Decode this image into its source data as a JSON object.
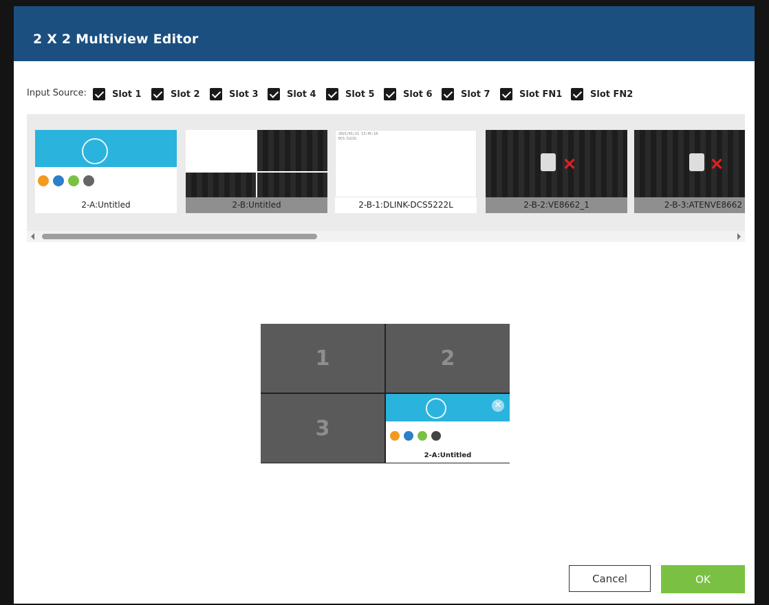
{
  "dialog": {
    "title": "2 X 2 Multiview Editor"
  },
  "input_source": {
    "label": "Input Source:",
    "slots": [
      {
        "label": "Slot 1",
        "checked": true
      },
      {
        "label": "Slot 2",
        "checked": true
      },
      {
        "label": "Slot 3",
        "checked": true
      },
      {
        "label": "Slot 4",
        "checked": true
      },
      {
        "label": "Slot 5",
        "checked": true
      },
      {
        "label": "Slot 6",
        "checked": true
      },
      {
        "label": "Slot 7",
        "checked": true
      },
      {
        "label": "Slot FN1",
        "checked": true
      },
      {
        "label": "Slot FN2",
        "checked": true
      }
    ]
  },
  "sources": [
    {
      "caption": "2-A:Untitled",
      "preview": "dashboard-screenshot"
    },
    {
      "caption": "2-B:Untitled",
      "preview": "quad-view-disconnected"
    },
    {
      "caption": "2-B-1:DLINK-DCS5222L",
      "preview": "camera-blank",
      "overlay_text": [
        "2021/01/21 13:45:18",
        "DCS-5222L"
      ]
    },
    {
      "caption": "2-B-2:VE8662_1",
      "preview": "disconnected-cable-icon"
    },
    {
      "caption": "2-B-3:ATENVE8662",
      "preview": "disconnected-cable-icon"
    }
  ],
  "layout": {
    "cells": [
      {
        "label": "1"
      },
      {
        "label": "2"
      },
      {
        "label": "3"
      },
      {
        "label": "",
        "assigned_source": "2-A:Untitled"
      }
    ]
  },
  "buttons": {
    "cancel": "Cancel",
    "ok": "OK"
  },
  "colors": {
    "titlebar": "#1b4f7f",
    "ok_button": "#7ac143",
    "empty_cell": "#5a5a5a"
  }
}
